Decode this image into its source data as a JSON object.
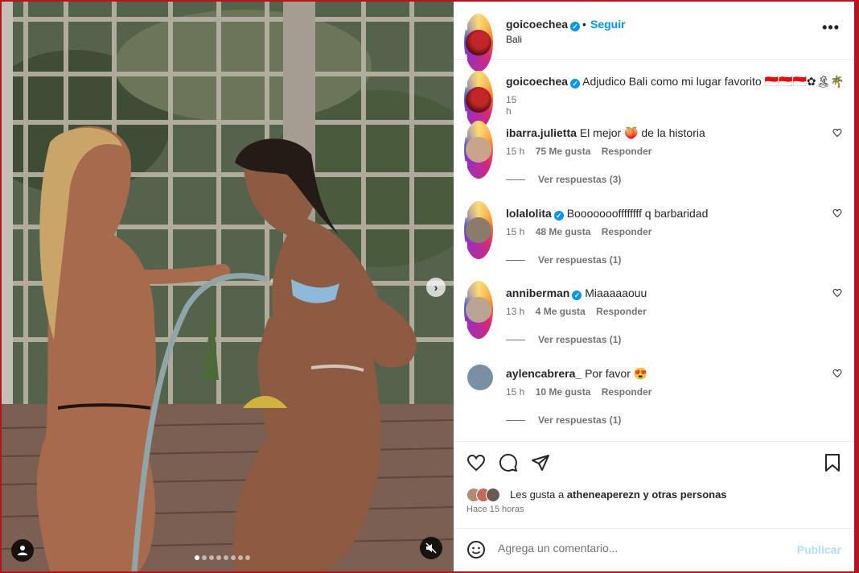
{
  "post": {
    "username": "goicoechea",
    "follow_label": "Seguir",
    "separator": "•",
    "location": "Bali",
    "more_label": "•••"
  },
  "caption": {
    "username": "goicoechea",
    "text": "Adjudico Bali como mi lugar favorito 🇮🇩🇮🇩🇮🇩✿🏝🌴",
    "time": "15 h"
  },
  "comments": [
    {
      "username": "ibarra.julietta",
      "verified": false,
      "text": "El mejor 🍑 de la historia",
      "time": "15 h",
      "likes": "75 Me gusta",
      "reply": "Responder",
      "replies": "Ver respuestas (3)",
      "avatar_color": "#c9a48a"
    },
    {
      "username": "lolalolita",
      "verified": true,
      "text": "Boooooooffffffff q barbaridad",
      "time": "15 h",
      "likes": "48 Me gusta",
      "reply": "Responder",
      "replies": "Ver respuestas (1)",
      "avatar_color": "#8a7b6d"
    },
    {
      "username": "anniberman",
      "verified": true,
      "text": "Miaaaaaouu",
      "time": "13 h",
      "likes": "4 Me gusta",
      "reply": "Responder",
      "replies": "Ver respuestas (1)",
      "avatar_color": "#b9a591"
    },
    {
      "username": "aylencabrera_",
      "verified": false,
      "text": "Por favor 😍",
      "time": "15 h",
      "likes": "10 Me gusta",
      "reply": "Responder",
      "replies": "Ver respuestas (1)",
      "avatar_color": "#7a8fa3"
    }
  ],
  "likes": {
    "prefix": "Les gusta a ",
    "user": "atheneaperezn",
    "suffix": " y otras personas",
    "ago": "Hace 15 horas"
  },
  "composer": {
    "placeholder": "Agrega un comentario...",
    "post_label": "Publicar"
  },
  "carousel": {
    "slide_count": 8,
    "active_index": 0
  },
  "icons": {
    "heart": "heart-icon",
    "comment": "comment-icon",
    "share": "share-icon",
    "save": "bookmark-icon",
    "emoji": "emoji-icon",
    "mute": "muted-speaker-icon",
    "tag": "user-tag-icon",
    "next": "chevron-right-icon"
  },
  "colors": {
    "accent": "#0095f6",
    "frame": "#b5161b",
    "muted_text": "#737373"
  }
}
